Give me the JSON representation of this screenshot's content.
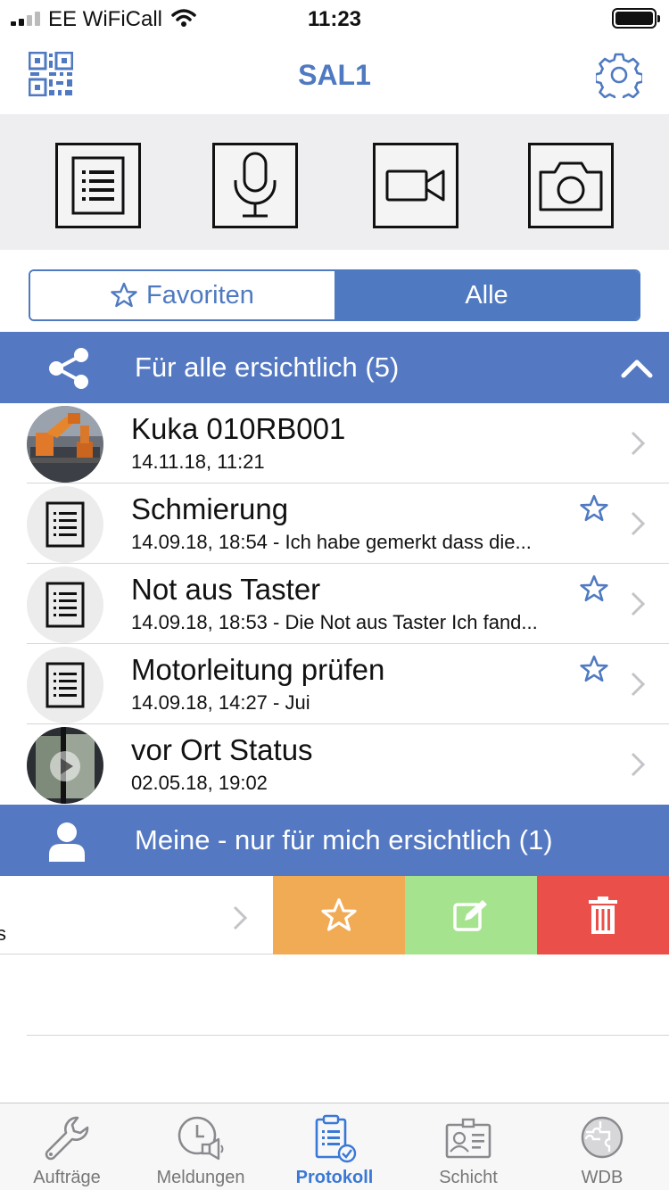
{
  "status_bar": {
    "carrier": "EE WiFiCall",
    "time": "11:23"
  },
  "nav": {
    "title": "SAL1"
  },
  "segment": {
    "favorites": "Favoriten",
    "all": "Alle"
  },
  "section_shared": {
    "label": "Für alle ersichtlich (5)"
  },
  "rows": [
    {
      "title": "Kuka 010RB001",
      "subtitle": "14.11.18, 11:21",
      "thumb": "photo-robot",
      "favorite": false
    },
    {
      "title": "Schmierung",
      "subtitle": "14.09.18, 18:54  -  Ich habe gemerkt dass die...",
      "thumb": "document-icon",
      "favorite": true
    },
    {
      "title": "Not aus Taster",
      "subtitle": "14.09.18, 18:53  -  Die Not aus Taster Ich fand...",
      "thumb": "document-icon",
      "favorite": true
    },
    {
      "title": "Motorleitung prüfen",
      "subtitle": "14.09.18, 14:27  -  Jui",
      "thumb": "document-icon",
      "favorite": true
    },
    {
      "title": "vor Ort Status",
      "subtitle": "02.05.18, 19:02",
      "thumb": "video-thumbnail",
      "favorite": false
    }
  ],
  "section_mine": {
    "label": "Meine - nur für mich ersichtlich (1)"
  },
  "swipe_row": {
    "fragment": "s"
  },
  "tabs": [
    {
      "label": "Aufträge",
      "icon": "wrench-icon"
    },
    {
      "label": "Meldungen",
      "icon": "clock-megaphone-icon"
    },
    {
      "label": "Protokoll",
      "icon": "clipboard-check-icon",
      "active": true
    },
    {
      "label": "Schicht",
      "icon": "badge-icon"
    },
    {
      "label": "WDB",
      "icon": "puzzle-globe-icon"
    }
  ],
  "colors": {
    "accent": "#5479c2",
    "favorite_action": "#f2ab55",
    "edit_action": "#a6e38f",
    "delete_action": "#ea4f4a",
    "active_tab": "#3a78d6"
  }
}
